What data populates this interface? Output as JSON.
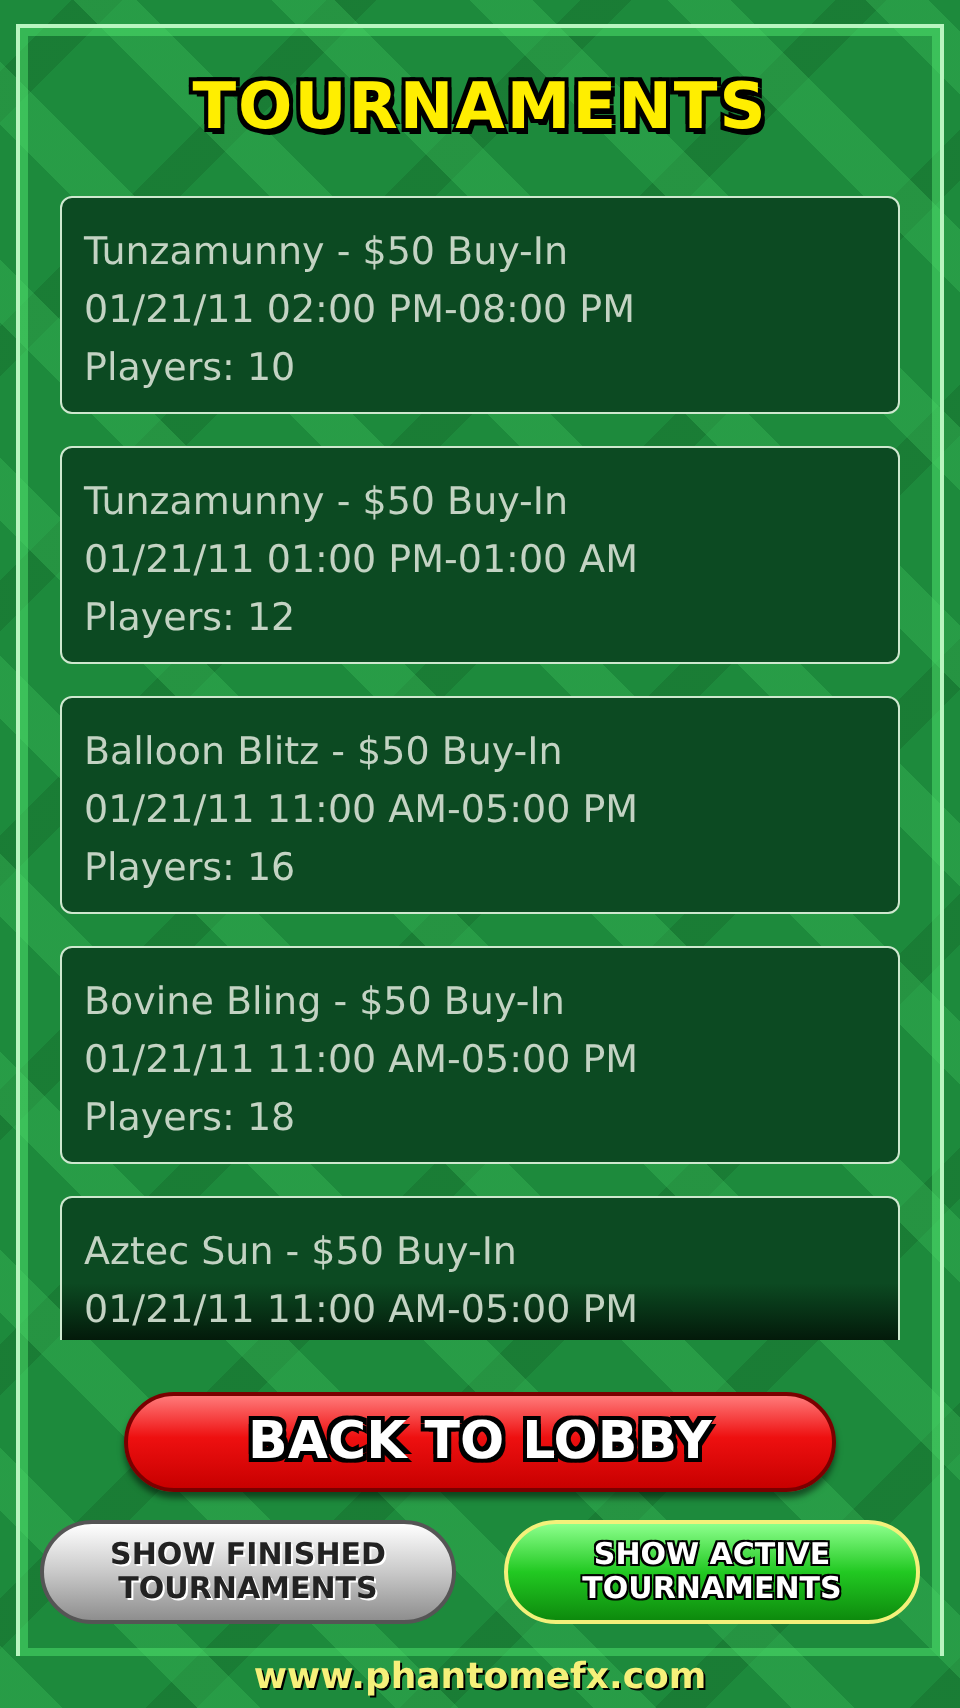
{
  "title": "TOURNAMENTS",
  "tournaments": [
    {
      "name": "Tunzamunny - $50 Buy-In",
      "schedule": "01/21/11 02:00 PM-08:00 PM",
      "players": "Players: 10"
    },
    {
      "name": "Tunzamunny - $50 Buy-In",
      "schedule": "01/21/11 01:00 PM-01:00 AM",
      "players": "Players: 12"
    },
    {
      "name": "Balloon Blitz - $50 Buy-In",
      "schedule": "01/21/11 11:00 AM-05:00 PM",
      "players": "Players: 16"
    },
    {
      "name": "Bovine Bling - $50 Buy-In",
      "schedule": "01/21/11 11:00 AM-05:00 PM",
      "players": "Players: 18"
    },
    {
      "name": "Aztec Sun - $50 Buy-In",
      "schedule": "01/21/11 11:00 AM-05:00 PM"
    }
  ],
  "back_button": "BACK TO LOBBY",
  "filters": [
    {
      "label": "SHOW FINISHED TOURNAMENTS",
      "selected": false
    },
    {
      "label": "SHOW ACTIVE TOURNAMENTS",
      "selected": true
    }
  ],
  "footer": "www.phantomefx.com"
}
